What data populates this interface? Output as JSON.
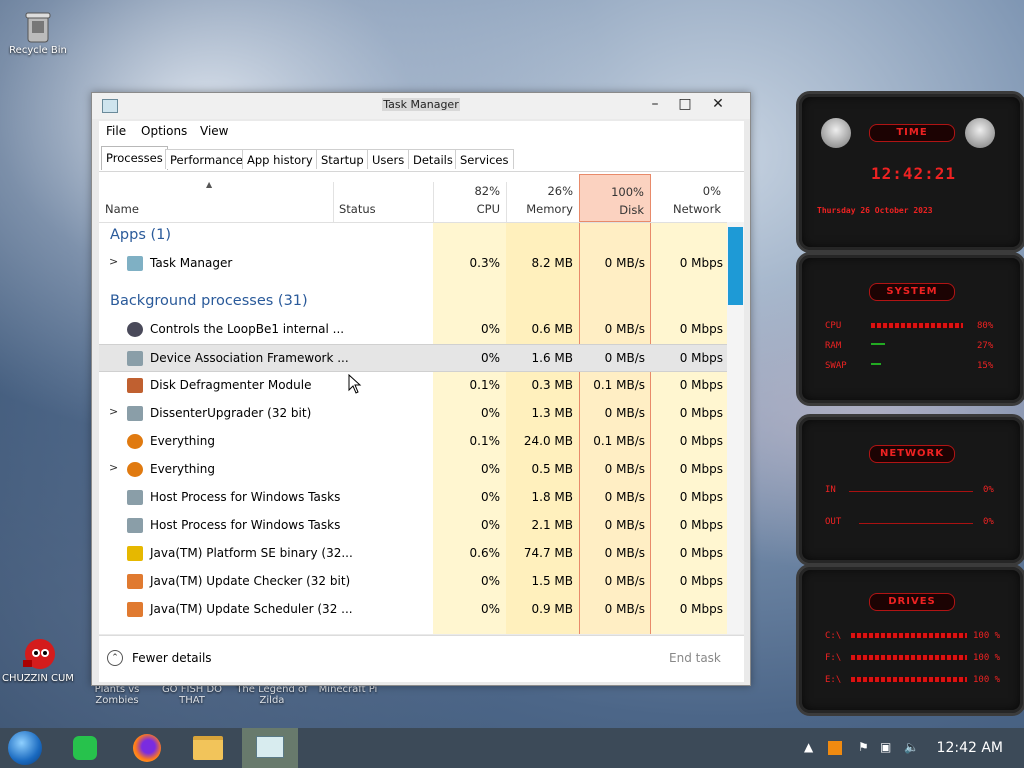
{
  "desktop": {
    "recycle_bin_label": "Recycle Bin",
    "icon_chuzzin": "CHUZZIN CUM",
    "icon_pvz": "Plants vs Zombies",
    "icon_gofish": "GO FISH DO THAT",
    "icon_zelda": "The Legend of Zilda",
    "icon_minecraft": "Minecraft Pi"
  },
  "window": {
    "title": "Task Manager",
    "menu": {
      "file": "File",
      "options": "Options",
      "view": "View"
    },
    "tabs": [
      "Processes",
      "Performance",
      "App history",
      "Startup",
      "Users",
      "Details",
      "Services"
    ],
    "columns": {
      "name": "Name",
      "status": "Status",
      "cpu_pct": "82%",
      "cpu": "CPU",
      "memory_pct": "26%",
      "memory": "Memory",
      "disk_pct": "100%",
      "disk": "Disk",
      "network_pct": "0%",
      "network": "Network"
    },
    "groups": {
      "apps": "Apps (1)",
      "background": "Background processes (31)"
    },
    "rows": [
      {
        "name": "Task Manager",
        "cpu": "0.3%",
        "memory": "8.2 MB",
        "disk": "0 MB/s",
        "network": "0 Mbps",
        "expand": ">"
      },
      {
        "name": "Controls the LoopBe1 internal ...",
        "cpu": "0%",
        "memory": "0.6 MB",
        "disk": "0 MB/s",
        "network": "0 Mbps",
        "expand": ""
      },
      {
        "name": "Device Association Framework ...",
        "cpu": "0%",
        "memory": "1.6 MB",
        "disk": "0 MB/s",
        "network": "0 Mbps",
        "expand": ""
      },
      {
        "name": "Disk Defragmenter Module",
        "cpu": "0.1%",
        "memory": "0.3 MB",
        "disk": "0.1 MB/s",
        "network": "0 Mbps",
        "expand": ""
      },
      {
        "name": "DissenterUpgrader (32 bit)",
        "cpu": "0%",
        "memory": "1.3 MB",
        "disk": "0 MB/s",
        "network": "0 Mbps",
        "expand": ">"
      },
      {
        "name": "Everything",
        "cpu": "0.1%",
        "memory": "24.0 MB",
        "disk": "0.1 MB/s",
        "network": "0 Mbps",
        "expand": ""
      },
      {
        "name": "Everything",
        "cpu": "0%",
        "memory": "0.5 MB",
        "disk": "0 MB/s",
        "network": "0 Mbps",
        "expand": ">"
      },
      {
        "name": "Host Process for Windows Tasks",
        "cpu": "0%",
        "memory": "1.8 MB",
        "disk": "0 MB/s",
        "network": "0 Mbps",
        "expand": ""
      },
      {
        "name": "Host Process for Windows Tasks",
        "cpu": "0%",
        "memory": "2.1 MB",
        "disk": "0 MB/s",
        "network": "0 Mbps",
        "expand": ""
      },
      {
        "name": "Java(TM) Platform SE binary (32...",
        "cpu": "0.6%",
        "memory": "74.7 MB",
        "disk": "0 MB/s",
        "network": "0 Mbps",
        "expand": ""
      },
      {
        "name": "Java(TM) Update Checker (32 bit)",
        "cpu": "0%",
        "memory": "1.5 MB",
        "disk": "0 MB/s",
        "network": "0 Mbps",
        "expand": ""
      },
      {
        "name": "Java(TM) Update Scheduler (32 ...",
        "cpu": "0%",
        "memory": "0.9 MB",
        "disk": "0 MB/s",
        "network": "0 Mbps",
        "expand": ""
      }
    ],
    "footer": {
      "fewer_details": "Fewer details",
      "end_task": "End task"
    }
  },
  "gadgets": {
    "time": {
      "title": "TIME",
      "clock": "12:42:21",
      "date": "Thursday 26 October 2023"
    },
    "system": {
      "title": "SYSTEM",
      "cpu": "CPU",
      "cpu_val": "80%",
      "ram": "RAM",
      "ram_val": "27%",
      "swap": "SWAP",
      "swap_val": "15%"
    },
    "network": {
      "title": "NETWORK",
      "in": "IN",
      "in_val": "0%",
      "out": "OUT",
      "out_val": "0%"
    },
    "drives": {
      "title": "DRIVES",
      "c": "C:\\",
      "c_val": "100 %",
      "f": "F:\\",
      "f_val": "100 %",
      "e": "E:\\",
      "e_val": "100 %"
    }
  },
  "taskbar": {
    "clock": "12:42 AM"
  },
  "colors": {
    "accent": "#1e9ad6",
    "group_text": "#2a5a9a",
    "gadget_red": "#e22222",
    "heat": "#fff4c4",
    "disk_heat": "#ffd8c8"
  }
}
